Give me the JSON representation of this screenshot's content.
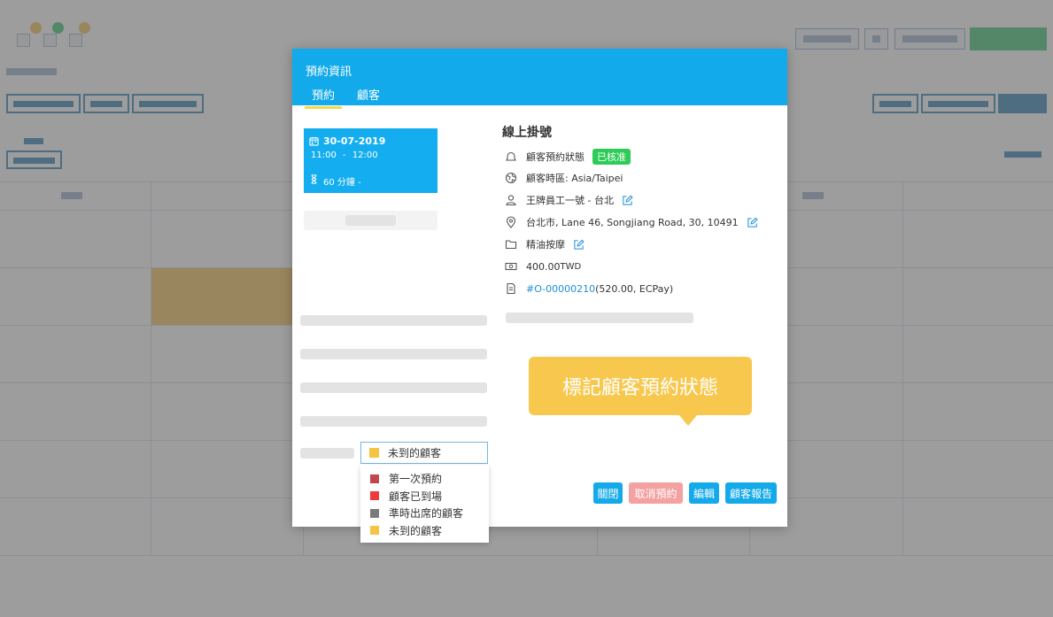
{
  "modal": {
    "title": "預約資訊",
    "tabs": [
      {
        "label": "預約",
        "active": true
      },
      {
        "label": "顧客",
        "active": false
      }
    ]
  },
  "appointment": {
    "date": "30-07-2019",
    "time_start": "11:00",
    "time_sep": "-",
    "time_end": "12:00",
    "duration": "60 分鐘 -",
    "service_title": "線上掛號",
    "status_label": "顧客預約狀態",
    "status_badge": "已核准",
    "timezone": "顧客時區: Asia/Taipei",
    "staff": "王牌員工一號 - 台北",
    "address": "台北市, Lane 46, Songjiang Road, 30, 10491",
    "service": "精油按摩",
    "price_amount": "400.00",
    "price_currency": "TWD",
    "order_link": "#O-00000210",
    "order_detail": "(520.00, ECPay)"
  },
  "tooltip": "標記顧客預約狀態",
  "status_select": {
    "selected": "未到的顧客",
    "selected_color": "#f6c343",
    "options": [
      {
        "label": "第一次預約",
        "color": "#c0474a"
      },
      {
        "label": "顧客已到場",
        "color": "#ee3a3a"
      },
      {
        "label": "準時出席的顧客",
        "color": "#7a7a7a"
      },
      {
        "label": "未到的顧客",
        "color": "#f6c343"
      }
    ]
  },
  "buttons": {
    "close": "關閉",
    "cancel": "取消預約",
    "edit": "編輯",
    "report": "顧客報告"
  },
  "colors": {
    "header": "#12aaea",
    "badge": "#2ecc57",
    "primary_button": "#14a9e8",
    "cancel_button": "#f4a1a1",
    "tooltip": "#f8c84e",
    "link": "#1e8fd6",
    "background_event": "#f3b33d",
    "background_action": "#1cb85a"
  }
}
